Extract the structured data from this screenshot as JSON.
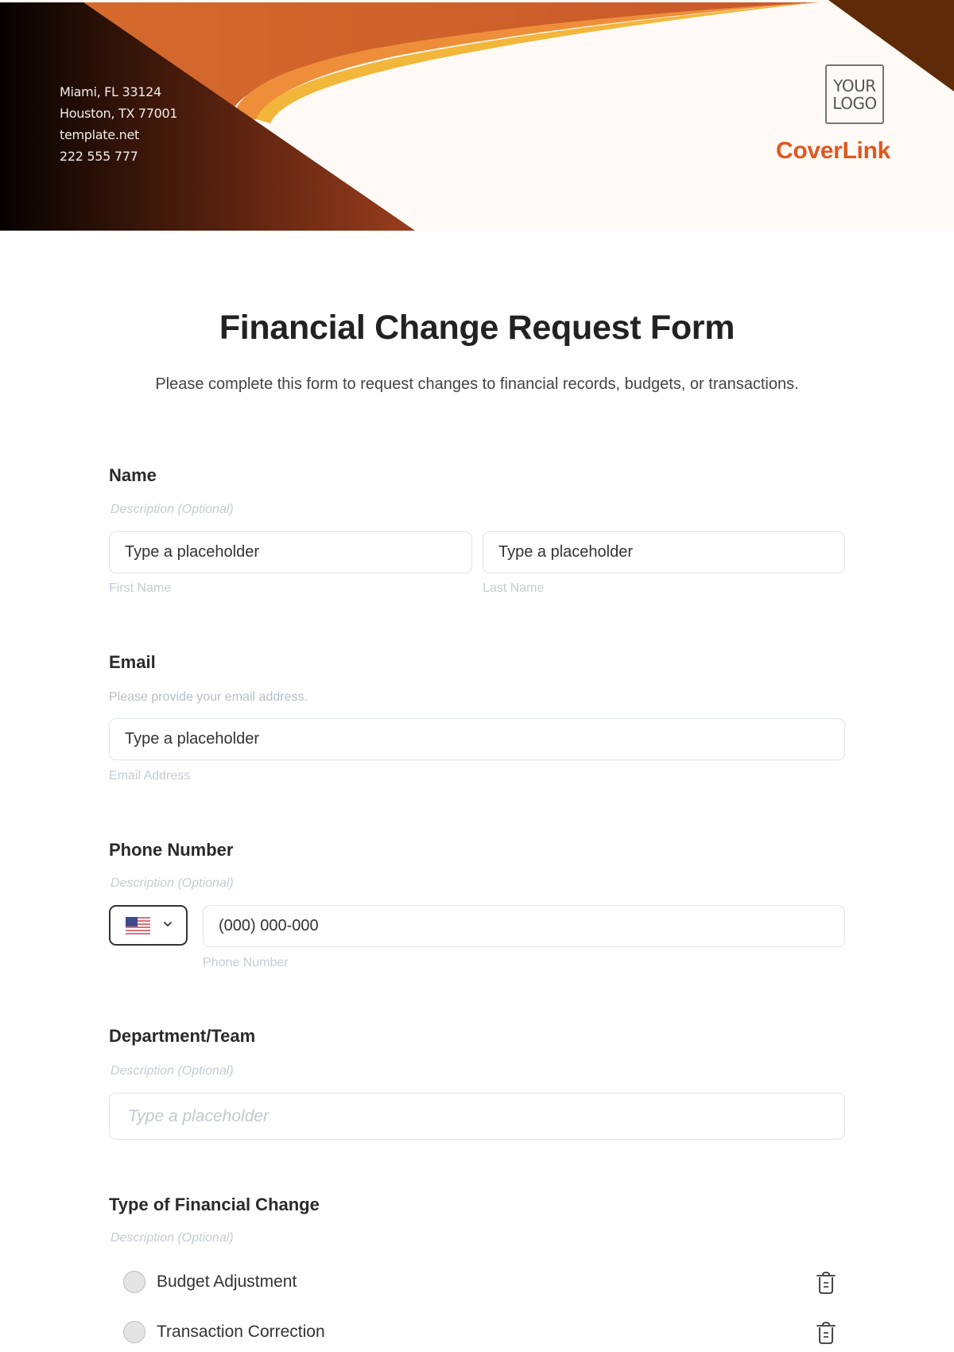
{
  "header": {
    "address_lines": [
      "Miami, FL 33124",
      "Houston, TX 77001",
      "template.net",
      "222 555 777"
    ],
    "logo_text_line1": "YOUR",
    "logo_text_line2": "LOGO",
    "brand_name": "CoverLink",
    "colors": {
      "brand": "#e0571e",
      "dark_brown": "#5e2a08",
      "orange": "#d2642a",
      "amber": "#f0b83a"
    }
  },
  "form": {
    "title": "Financial Change Request Form",
    "subtitle": "Please complete this form to request changes to financial records, budgets, or transactions.",
    "fields": {
      "name": {
        "label": "Name",
        "description": "Description (Optional)",
        "first": {
          "placeholder": "Type a placeholder",
          "sublabel": "First Name"
        },
        "last": {
          "placeholder": "Type a placeholder",
          "sublabel": "Last Name"
        }
      },
      "email": {
        "label": "Email",
        "description": "Please provide your email address.",
        "placeholder": "Type a placeholder",
        "sublabel": "Email Address"
      },
      "phone": {
        "label": "Phone Number",
        "description": "Description (Optional)",
        "country_icon": "us-flag-icon",
        "placeholder": "(000) 000-000",
        "sublabel": "Phone Number"
      },
      "department": {
        "label": "Department/Team",
        "description": "Description (Optional)",
        "placeholder": "Type a placeholder"
      },
      "change_type": {
        "label": "Type of Financial Change",
        "description": "Description (Optional)",
        "options": [
          {
            "label": "Budget Adjustment",
            "selected": false,
            "icon": "trash-icon"
          },
          {
            "label": "Transaction Correction",
            "selected": false,
            "icon": "trash-icon"
          }
        ]
      }
    }
  }
}
